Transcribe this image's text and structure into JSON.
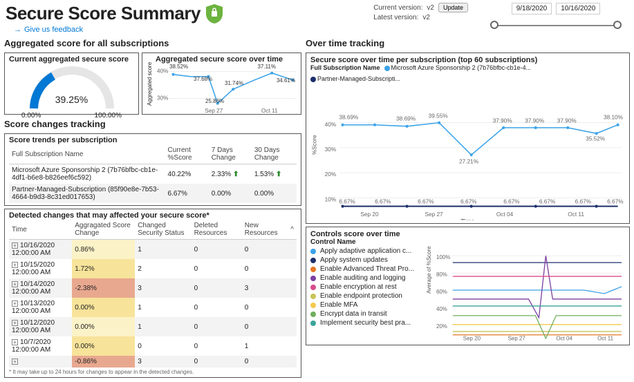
{
  "header": {
    "title": "Secure Score Summary",
    "feedback": "Give us feedback",
    "current_version_label": "Current version:",
    "current_version": "v2",
    "latest_version_label": "Latest version:",
    "latest_version": "v2",
    "update_btn": "Update",
    "date_start": "9/18/2020",
    "date_end": "10/16/2020"
  },
  "agg": {
    "section": "Aggregated score for all subscriptions",
    "gauge_title": "Current aggregated secure score",
    "gauge_value": "39.25%",
    "gauge_min": "0.00%",
    "gauge_max": "100.00%",
    "spark_title": "Aggregated secure score over time",
    "spark_yaxis": "Aggregated score",
    "spark_y40": "40%",
    "spark_y30": "30%",
    "pt1": "38.52%",
    "pt2": "37.68%",
    "pt3": "25.86%",
    "pt4": "31.74%",
    "pt5": "37.11%",
    "pt6": "34.61%",
    "x1": "Sep 27",
    "x2": "Oct 11"
  },
  "trends": {
    "section": "Score changes tracking",
    "sub": "Score trends per subscription",
    "col_name": "Full Subscription Name",
    "col_cur": "Current %Score",
    "col_7d": "7 Days Change",
    "col_30d": "30 Days Change",
    "rows": [
      {
        "name": "Microsoft Azure Sponsorship 2 (7b76bfbc-cb1e-4df1-b6e8-b826eef6c592)",
        "cur": "40.22%",
        "d7": "2.33%",
        "d30": "1.53%",
        "up": true
      },
      {
        "name": "Partner-Managed-Subscription (85f90e8e-7b53-4664-b9d3-8c31ed017653)",
        "cur": "6.67%",
        "d7": "0.00%",
        "d30": "0.00%",
        "up": false
      }
    ]
  },
  "changes": {
    "sub": "Detected changes that may affected your secure score*",
    "col_time": "Time",
    "col_agg": "Aggragated Score Change",
    "col_sec": "Changed Security Status",
    "col_del": "Deleted Resources",
    "col_new": "New Resources",
    "rows": [
      {
        "time": "10/16/2020 12:00:00 AM",
        "agg": "0.86%",
        "sec": "1",
        "del": "0",
        "new": "0",
        "cls": "hl-lyellow"
      },
      {
        "time": "10/15/2020 12:00:00 AM",
        "agg": "1.72%",
        "sec": "2",
        "del": "0",
        "new": "0",
        "cls": "hl-yellow"
      },
      {
        "time": "10/14/2020 12:00:00 AM",
        "agg": "-2.38%",
        "sec": "3",
        "del": "0",
        "new": "3",
        "cls": "hl-red"
      },
      {
        "time": "10/13/2020 12:00:00 AM",
        "agg": "0.00%",
        "sec": "1",
        "del": "0",
        "new": "0",
        "cls": "hl-yellow"
      },
      {
        "time": "10/12/2020 12:00:00 AM",
        "agg": "0.00%",
        "sec": "1",
        "del": "0",
        "new": "0",
        "cls": "hl-lyellow"
      },
      {
        "time": "10/7/2020 12:00:00 AM",
        "agg": "0.00%",
        "sec": "0",
        "del": "0",
        "new": "1",
        "cls": "hl-yellow"
      },
      {
        "time": "",
        "agg": "-0.86%",
        "sec": "3",
        "del": "0",
        "new": "0",
        "cls": "hl-red"
      }
    ],
    "footnote": "* It may take up to 24 hours for changes to appear in the detected changes."
  },
  "over_time": {
    "section": "Over time tracking",
    "sub": "Secure score over time per subscription (top 60 subscriptions)",
    "legend_label": "Full Subscription Name",
    "series1": "Microsoft Azure Sponsorship 2 (7b76bfbc-cb1e-4...",
    "series2": "Partner-Managed-Subscripti...",
    "ylabel": "%Score",
    "xlabel": "Time",
    "ticks_x": [
      "Sep 20",
      "Sep 27",
      "Oct 04",
      "Oct 11"
    ],
    "labels": [
      "38.69%",
      "38.69%",
      "39.55%",
      "27.21%",
      "37.90%",
      "37.90%",
      "37.90%",
      "35.52%",
      "38.10%"
    ],
    "low_labels": "6.67%"
  },
  "controls": {
    "section": "Controls score over time",
    "legend_header": "Control Name",
    "ylabel": "Average of %Score",
    "items": [
      {
        "name": "Apply adaptive application c...",
        "color": "#3ba3e8"
      },
      {
        "name": "Apply system updates",
        "color": "#1b2f6b"
      },
      {
        "name": "Enable Advanced Threat Pro...",
        "color": "#e87722"
      },
      {
        "name": "Enable auditing and logging",
        "color": "#7b3fa0"
      },
      {
        "name": "Enable encryption at rest",
        "color": "#d94a8c"
      },
      {
        "name": "Enable endpoint protection",
        "color": "#c8c25a"
      },
      {
        "name": "Enable MFA",
        "color": "#f2c94c"
      },
      {
        "name": "Encrypt data in transit",
        "color": "#6fae5e"
      },
      {
        "name": "Implement security best pra...",
        "color": "#3aa59b"
      }
    ],
    "ticks_x": [
      "Sep 20",
      "Sep 27",
      "Oct 04",
      "Oct 11"
    ],
    "ticks_y": [
      "20%",
      "40%",
      "60%",
      "80%",
      "100%"
    ]
  },
  "chart_data": [
    {
      "type": "line",
      "title": "Aggregated secure score over time",
      "ylabel": "Aggregated score",
      "ylim": [
        25,
        40
      ],
      "x": [
        "Sep 20",
        "Sep 24",
        "Sep 27",
        "Oct 01",
        "Oct 05",
        "Oct 11",
        "Oct 15"
      ],
      "values": [
        38.52,
        37.68,
        25.86,
        31.74,
        35.0,
        37.11,
        34.61
      ]
    },
    {
      "type": "line",
      "title": "Secure score over time per subscription (top 60 subscriptions)",
      "ylabel": "%Score",
      "xlabel": "Time",
      "ylim": [
        0,
        45
      ],
      "x": [
        "Sep 18",
        "Sep 20",
        "Sep 24",
        "Sep 27",
        "Oct 01",
        "Oct 04",
        "Oct 07",
        "Oct 11",
        "Oct 14",
        "Oct 16"
      ],
      "series": [
        {
          "name": "Microsoft Azure Sponsorship 2",
          "color": "#3ba3e8",
          "values": [
            38.69,
            38.69,
            38.69,
            39.55,
            27.21,
            37.9,
            37.9,
            37.9,
            35.52,
            38.1
          ]
        },
        {
          "name": "Partner-Managed-Subscription",
          "color": "#1b2f6b",
          "values": [
            6.67,
            6.67,
            6.67,
            6.67,
            6.67,
            6.67,
            6.67,
            6.67,
            6.67,
            6.67
          ]
        }
      ]
    },
    {
      "type": "line",
      "title": "Controls score over time",
      "ylabel": "Average of %Score",
      "ylim": [
        0,
        100
      ],
      "x": [
        "Sep 18",
        "Sep 20",
        "Sep 24",
        "Sep 27",
        "Oct 01",
        "Oct 04",
        "Oct 07",
        "Oct 11",
        "Oct 14",
        "Oct 16"
      ],
      "series": [
        {
          "name": "Apply adaptive application c...",
          "color": "#3ba3e8",
          "values": [
            60,
            60,
            60,
            60,
            60,
            60,
            60,
            60,
            55,
            60
          ]
        },
        {
          "name": "Apply system updates",
          "color": "#1b2f6b",
          "values": [
            92,
            92,
            92,
            92,
            92,
            92,
            92,
            92,
            92,
            92
          ]
        },
        {
          "name": "Enable Advanced Threat Pro...",
          "color": "#e87722",
          "values": [
            8,
            8,
            8,
            8,
            8,
            8,
            8,
            8,
            8,
            8
          ]
        },
        {
          "name": "Enable auditing and logging",
          "color": "#7b3fa0",
          "values": [
            52,
            52,
            52,
            52,
            30,
            100,
            52,
            52,
            52,
            52
          ]
        },
        {
          "name": "Enable encryption at rest",
          "color": "#d94a8c",
          "values": [
            78,
            78,
            78,
            78,
            78,
            78,
            78,
            78,
            78,
            78
          ]
        },
        {
          "name": "Enable endpoint protection",
          "color": "#c8c25a",
          "values": [
            12,
            12,
            12,
            12,
            12,
            12,
            12,
            12,
            12,
            12
          ]
        },
        {
          "name": "Enable MFA",
          "color": "#f2c94c",
          "values": [
            20,
            20,
            20,
            20,
            20,
            20,
            20,
            20,
            20,
            20
          ]
        },
        {
          "name": "Encrypt data in transit",
          "color": "#6fae5e",
          "values": [
            30,
            30,
            30,
            30,
            30,
            0,
            30,
            30,
            30,
            30
          ]
        },
        {
          "name": "Implement security best pra...",
          "color": "#3aa59b",
          "values": [
            42,
            42,
            42,
            42,
            42,
            42,
            42,
            42,
            42,
            42
          ]
        }
      ]
    }
  ]
}
